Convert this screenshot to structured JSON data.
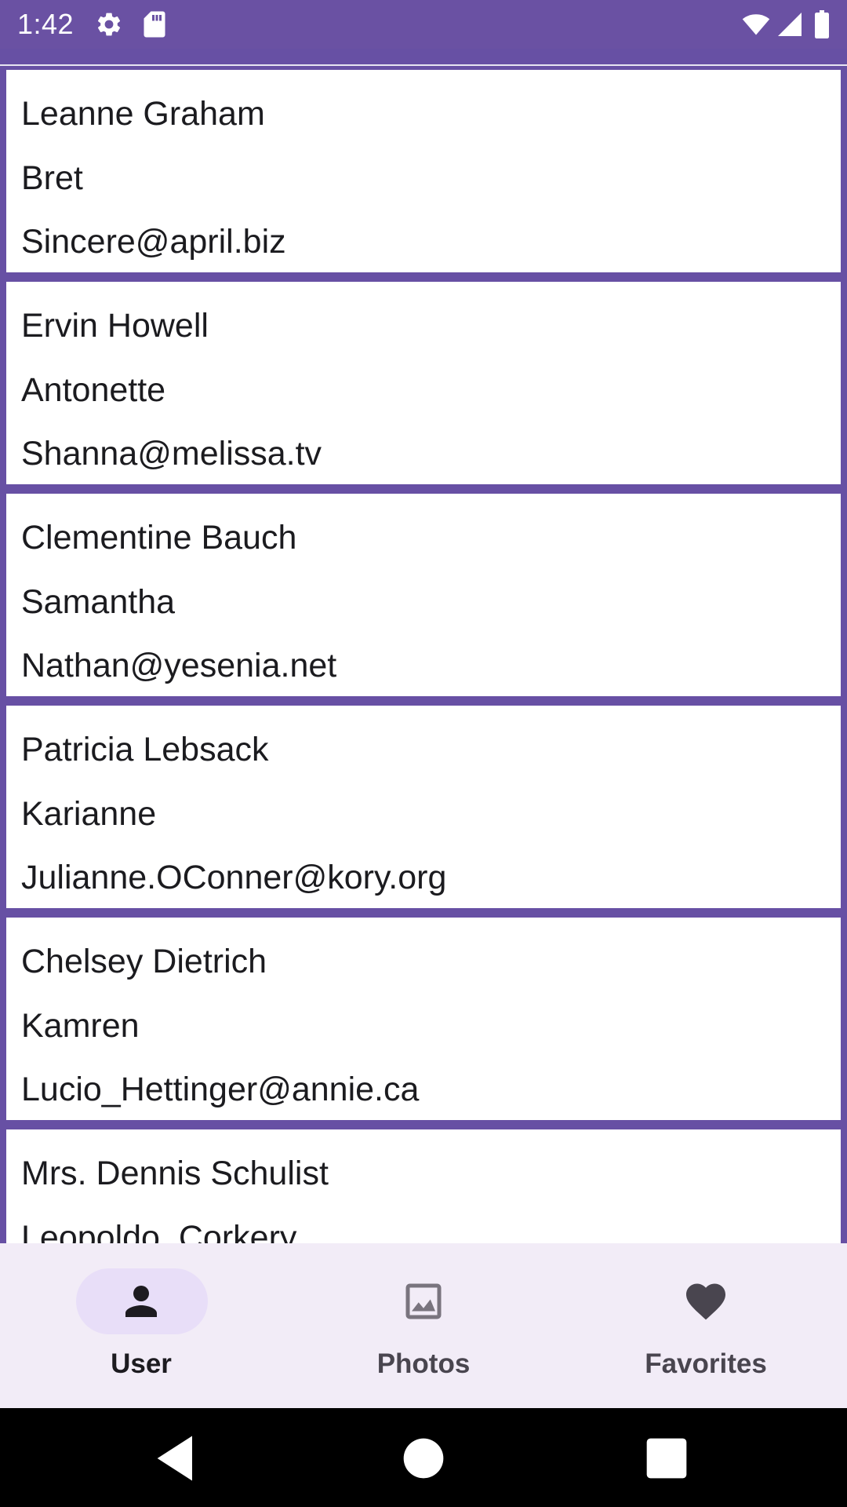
{
  "status_bar": {
    "time": "1:42",
    "left_icons": [
      "gear-icon",
      "sd-card-icon"
    ],
    "right_icons": [
      "wifi-icon",
      "signal-icon",
      "battery-icon"
    ],
    "background": "#6a51a3"
  },
  "users": [
    {
      "name": "Leanne Graham",
      "username": "Bret",
      "email": "Sincere@april.biz"
    },
    {
      "name": "Ervin Howell",
      "username": "Antonette",
      "email": "Shanna@melissa.tv"
    },
    {
      "name": "Clementine Bauch",
      "username": "Samantha",
      "email": "Nathan@yesenia.net"
    },
    {
      "name": "Patricia Lebsack",
      "username": "Karianne",
      "email": "Julianne.OConner@kory.org"
    },
    {
      "name": "Chelsey Dietrich",
      "username": "Kamren",
      "email": "Lucio_Hettinger@annie.ca"
    },
    {
      "name": "Mrs. Dennis Schulist",
      "username": "Leopoldo_Corkery",
      "email": ""
    }
  ],
  "bottom_nav": {
    "items": [
      {
        "label": "User",
        "icon": "person-icon",
        "selected": true
      },
      {
        "label": "Photos",
        "icon": "image-icon",
        "selected": false
      },
      {
        "label": "Favorites",
        "icon": "heart-icon",
        "selected": false
      }
    ],
    "background": "#f2ecf7",
    "active_indicator": "#e8def8"
  },
  "system_nav": {
    "buttons": [
      "back-icon",
      "home-icon",
      "recents-icon"
    ]
  },
  "colors": {
    "primary": "#6750a4",
    "card": "#ffffff",
    "text": "#1b1b1f"
  }
}
